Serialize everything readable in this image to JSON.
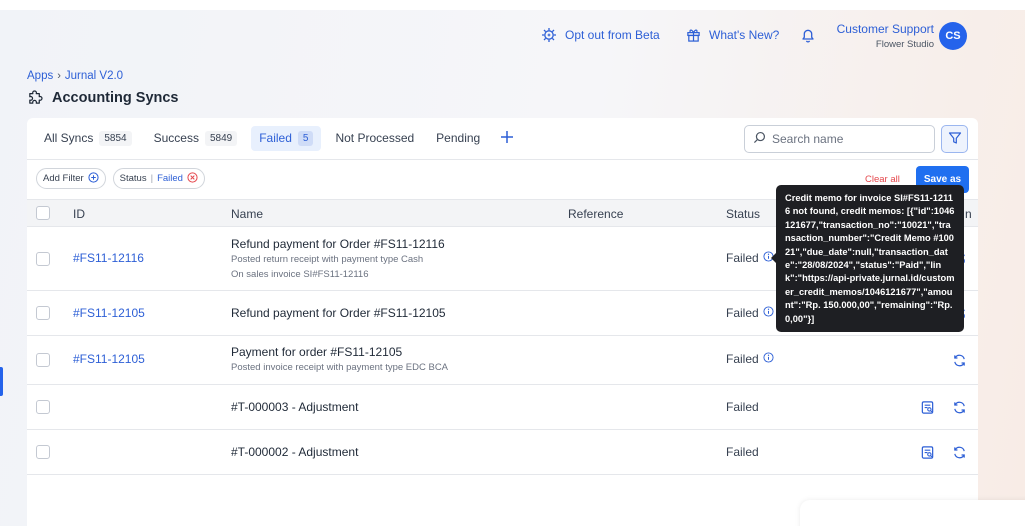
{
  "header": {
    "opt_out_label": "Opt out from Beta",
    "whats_new_label": "What's New?",
    "user_name": "Customer Support",
    "user_org": "Flower Studio",
    "avatar_initials": "CS"
  },
  "breadcrumb": {
    "root": "Apps",
    "sep": "›",
    "current": "Jurnal V2.0"
  },
  "page": {
    "title": "Accounting Syncs"
  },
  "tabs": [
    {
      "label": "All Syncs",
      "count": "5854"
    },
    {
      "label": "Success",
      "count": "5849"
    },
    {
      "label": "Failed",
      "count": "5"
    },
    {
      "label": "Not Processed"
    },
    {
      "label": "Pending"
    }
  ],
  "search": {
    "placeholder": "Search name"
  },
  "filters": {
    "add_filter_label": "Add Filter",
    "status_label": "Status",
    "status_value": "Failed",
    "clear_all_label": "Clear all",
    "save_as_label": "Save as"
  },
  "table": {
    "columns": {
      "id": "ID",
      "name": "Name",
      "reference": "Reference",
      "status": "Status",
      "action_partial": "n"
    },
    "rows": [
      {
        "id": "#FS11-12116",
        "name": "Refund payment for Order #FS11-12116",
        "sub1": "Posted return receipt with payment type Cash",
        "sub2": "On sales invoice SI#FS11-12116",
        "status": "Failed"
      },
      {
        "id": "#FS11-12105",
        "name": "Refund payment for Order #FS11-12105",
        "status": "Failed"
      },
      {
        "id": "#FS11-12105",
        "name": "Payment for order #FS11-12105",
        "sub1": "Posted invoice receipt with payment type EDC BCA",
        "status": "Failed"
      },
      {
        "id": "",
        "name": "#T-000003 - Adjustment",
        "status": "Failed"
      },
      {
        "id": "",
        "name": "#T-000002 - Adjustment",
        "status": "Failed"
      }
    ]
  },
  "tooltip": {
    "text": "Credit memo for invoice SI#FS11-12116 not found, credit memos: [{\"id\":1046121677,\"transaction_no\":\"10021\",\"transaction_number\":\"Credit Memo #10021\",\"due_date\":null,\"transaction_date\":\"28/08/2024\",\"status\":\"Paid\",\"link\":\"https://api-private.jurnal.id/customer_credit_memos/1046121677\",\"amount\":\"Rp. 150.000,00\",\"remaining\":\"Rp. 0,00\"}]"
  },
  "colors": {
    "accent": "#2d5fd6",
    "primary_button": "#1f6ff0",
    "danger": "#e5484d",
    "tooltip_bg": "#1e1f23"
  },
  "icons": [
    "sparkle-gear-icon",
    "gift-icon",
    "bell-icon",
    "puzzle-icon",
    "search-icon",
    "filter-icon",
    "plus-circle-icon",
    "close-circle-icon",
    "info-icon",
    "sync-icon",
    "journal-icon"
  ]
}
